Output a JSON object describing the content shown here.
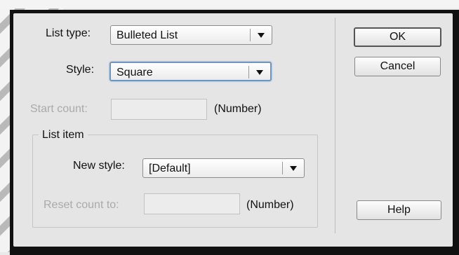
{
  "dialog": {
    "list_type": {
      "label": "List type:",
      "value": "Bulleted List"
    },
    "style": {
      "label": "Style:",
      "value": "Square"
    },
    "start_count": {
      "label": "Start count:",
      "value": "",
      "hint": "(Number)"
    },
    "list_item": {
      "title": "List item",
      "new_style": {
        "label": "New style:",
        "value": "[Default]"
      },
      "reset_count": {
        "label": "Reset count to:",
        "value": "",
        "hint": "(Number)"
      }
    },
    "buttons": {
      "ok": "OK",
      "cancel": "Cancel",
      "help": "Help"
    }
  }
}
